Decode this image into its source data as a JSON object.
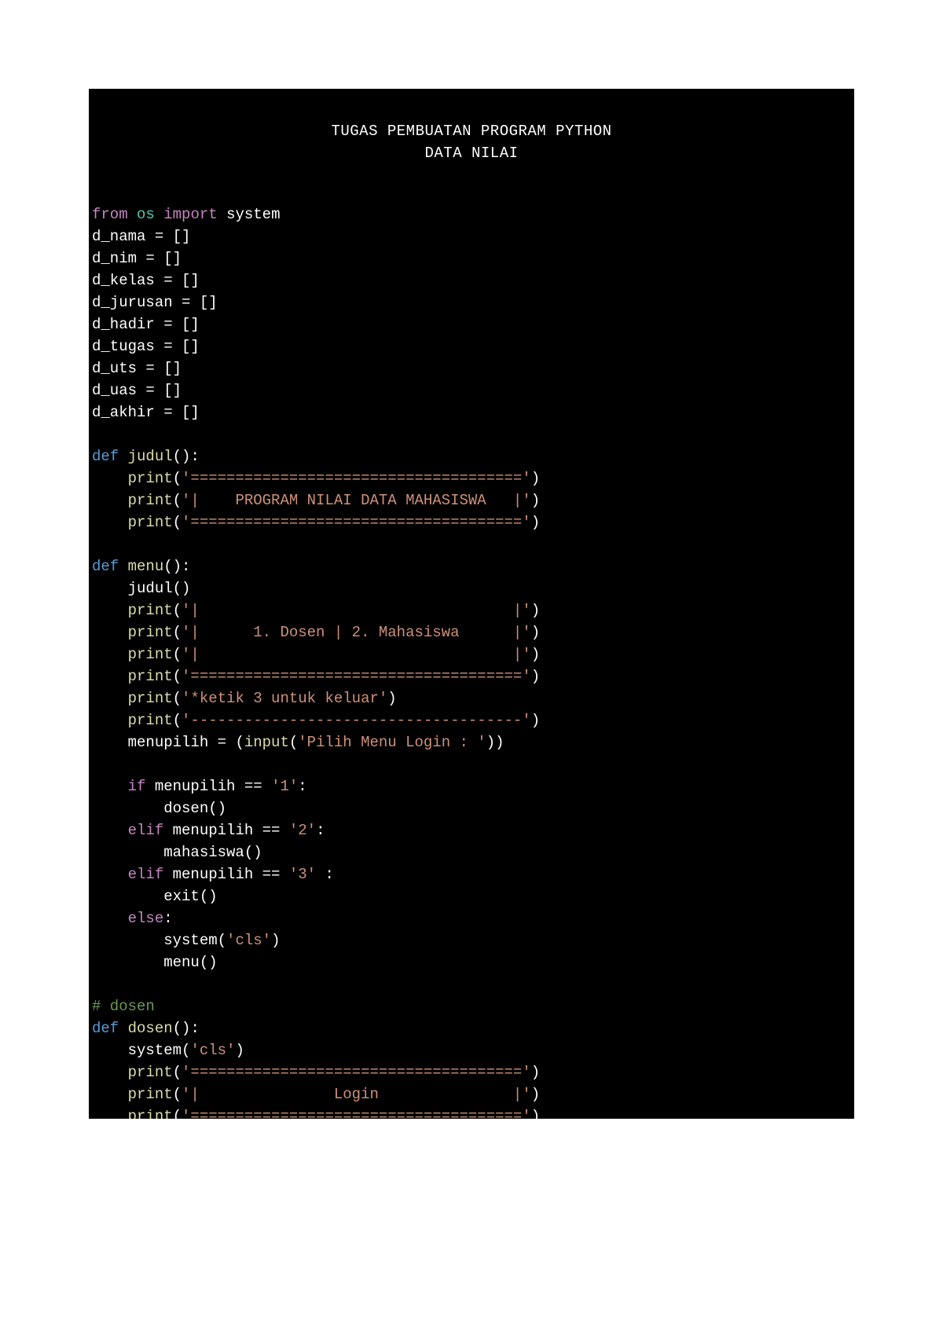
{
  "title_line1": "TUGAS PEMBUATAN PROGRAM PYTHON",
  "title_line2": "DATA NILAI",
  "code": {
    "import_from": "from",
    "import_mod": "os",
    "import_kw": "import",
    "import_name": "system",
    "decl1": "d_nama = []",
    "decl2": "d_nim = []",
    "decl3": "d_kelas = []",
    "decl4": "d_jurusan = []",
    "decl5": "d_hadir = []",
    "decl6": "d_tugas = []",
    "decl7": "d_uts = []",
    "decl8": "d_uas = []",
    "decl9": "d_akhir = []",
    "def_kw": "def",
    "fn_judul": "judul",
    "fn_menu": "menu",
    "fn_dosen": "dosen",
    "print_call": "print",
    "input_call": "input",
    "system_call": "system",
    "exit_call": "exit",
    "mahasiswa_call": "mahasiswa",
    "str_equals_line": "'====================================='",
    "str_program_header": "'|    PROGRAM NILAI DATA MAHASISWA   |'",
    "str_empty_row": "'|                                   |'",
    "str_menu_options": "'|      1. Dosen | 2. Mahasiswa      |'",
    "str_ketik3": "'*ketik 3 untuk keluar'",
    "str_dashes": "'-------------------------------------'",
    "str_pilih_menu": "'Pilih Menu Login : '",
    "str_one": "'1'",
    "str_two": "'2'",
    "str_three": "'3'",
    "str_cls": "'cls'",
    "str_login": "'|               Login               |'",
    "comment_dosen": "# dosen",
    "if_kw": "if",
    "elif_kw": "elif",
    "else_kw": "else",
    "menupilih_var": "menupilih",
    "judul_call": "judul",
    "menu_call": "menu",
    "dosen_call": "dosen"
  }
}
